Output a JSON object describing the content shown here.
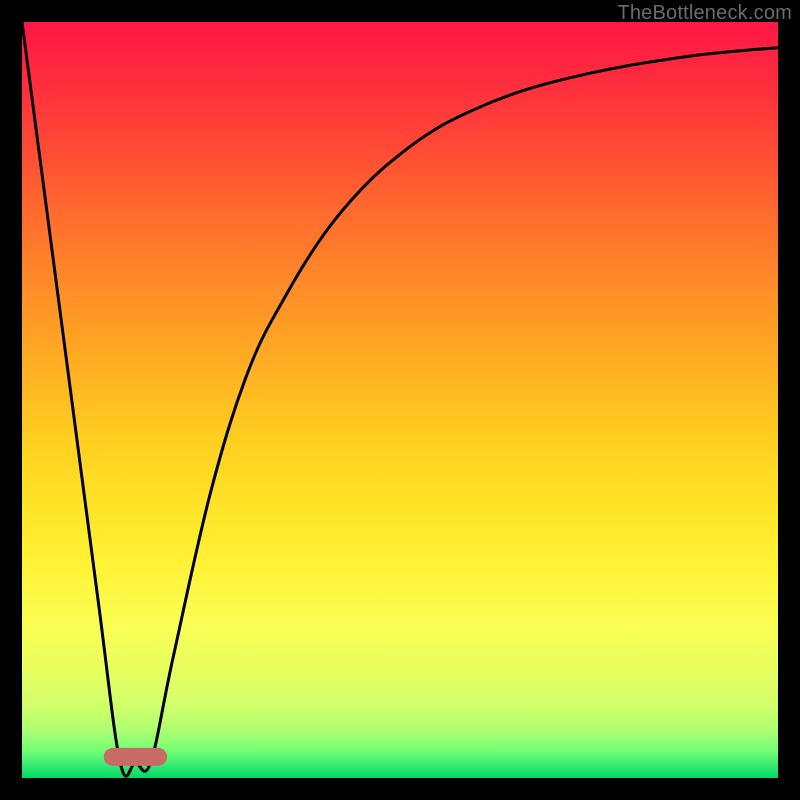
{
  "watermark": "TheBottleneck.com",
  "chart_data": {
    "type": "line",
    "title": "",
    "xlabel": "",
    "ylabel": "",
    "xlim": [
      0,
      100
    ],
    "ylim": [
      0,
      100
    ],
    "grid": false,
    "series": [
      {
        "name": "curve",
        "x": [
          0,
          5,
          10,
          13,
          15,
          17,
          20,
          25,
          30,
          35,
          40,
          45,
          50,
          55,
          60,
          65,
          70,
          75,
          80,
          85,
          90,
          95,
          100
        ],
        "y": [
          100,
          62,
          24,
          2,
          2,
          2,
          16,
          38,
          54,
          64,
          72,
          78,
          82.5,
          86,
          88.5,
          90.5,
          92,
          93.2,
          94.2,
          95,
          95.7,
          96.2,
          96.6
        ]
      }
    ],
    "flat_region": {
      "x_start": 12,
      "x_end": 18,
      "color": "#c86a65"
    },
    "gradient_stops": [
      {
        "offset": 0.0,
        "color": "#ff1744"
      },
      {
        "offset": 0.07,
        "color": "#ff2a3f"
      },
      {
        "offset": 0.15,
        "color": "#ff4436"
      },
      {
        "offset": 0.25,
        "color": "#ff6a2e"
      },
      {
        "offset": 0.35,
        "color": "#ff8c28"
      },
      {
        "offset": 0.45,
        "color": "#ffad22"
      },
      {
        "offset": 0.55,
        "color": "#ffce20"
      },
      {
        "offset": 0.65,
        "color": "#ffe628"
      },
      {
        "offset": 0.73,
        "color": "#fff43a"
      },
      {
        "offset": 0.8,
        "color": "#faff55"
      },
      {
        "offset": 0.86,
        "color": "#e6ff60"
      },
      {
        "offset": 0.905,
        "color": "#d0ff6a"
      },
      {
        "offset": 0.935,
        "color": "#b0ff70"
      },
      {
        "offset": 0.965,
        "color": "#70ff75"
      },
      {
        "offset": 0.985,
        "color": "#30e870"
      },
      {
        "offset": 1.0,
        "color": "#00d968"
      }
    ]
  }
}
